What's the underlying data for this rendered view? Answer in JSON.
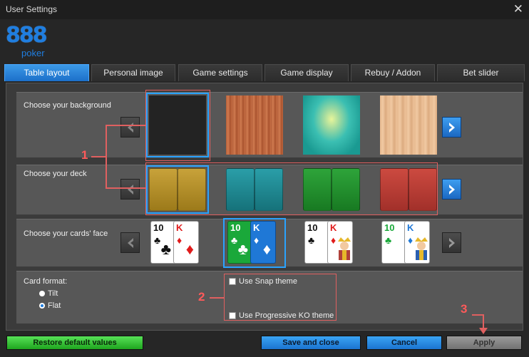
{
  "window": {
    "title": "User Settings",
    "close_icon": "close-icon"
  },
  "logo": {
    "numerals": "888",
    "word": "poker",
    "color": "#1f7ee0"
  },
  "tabs": [
    {
      "label": "Table layout",
      "active": true
    },
    {
      "label": "Personal image",
      "active": false
    },
    {
      "label": "Game settings",
      "active": false
    },
    {
      "label": "Game display",
      "active": false
    },
    {
      "label": "Rebuy / Addon",
      "active": false
    },
    {
      "label": "Bet slider",
      "active": false
    }
  ],
  "background": {
    "label": "Choose your background",
    "options": [
      "dark",
      "wood-red",
      "teal-diamond",
      "wood-light"
    ],
    "selected_index": 0
  },
  "deck": {
    "label": "Choose your deck",
    "options": [
      "gold",
      "teal",
      "green",
      "red"
    ],
    "selected_index": 0
  },
  "cards_face": {
    "label": "Choose your cards' face",
    "options": [
      "classic",
      "four-color",
      "classic-royal",
      "four-color-royal"
    ],
    "selected_index": 1,
    "ranks": [
      "10",
      "K"
    ]
  },
  "card_format": {
    "label": "Card format:",
    "options": [
      {
        "label": "Tilt",
        "checked": false
      },
      {
        "label": "Flat",
        "checked": true
      }
    ]
  },
  "themes": [
    {
      "label": "Use Snap theme",
      "checked": false
    },
    {
      "label": "Use Progressive KO theme",
      "checked": false
    }
  ],
  "annotations": [
    "1",
    "2",
    "3"
  ],
  "buttons": {
    "restore": "Restore default values",
    "save_close": "Save and close",
    "cancel": "Cancel",
    "apply": "Apply"
  },
  "colors": {
    "accent": "#2aa3ff",
    "annotation": "#e06060",
    "green": "#1fa51f"
  }
}
